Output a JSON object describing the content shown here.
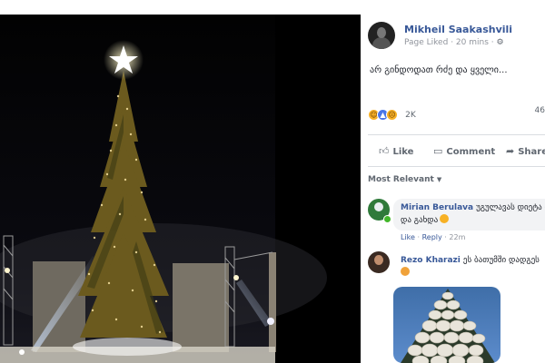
{
  "post": {
    "page_name": "Mikheil Saakashvili",
    "meta_status": "Page Liked",
    "meta_time": "20 mins",
    "text": "არ გინდოდათ რძე და ყველი...",
    "reaction_count": "2K",
    "comment_count": "46"
  },
  "actions": {
    "like": "Like",
    "comment": "Comment",
    "share": "Share"
  },
  "sort_label": "Most Relevant",
  "comments": [
    {
      "author": "Mirian Berulava",
      "text_line1": "უგულავას დიეტა დ",
      "text_line2": "და გახდა",
      "like": "Like",
      "reply": "Reply",
      "time": "22m"
    },
    {
      "author": "Rezo Kharazi",
      "text_line1": "ეს ბათუმში დადგეს"
    }
  ],
  "colors": {
    "link_blue": "#385898",
    "secondary_gray": "#606770",
    "bubble_gray": "#f2f3f5",
    "online_green": "#42b72a"
  },
  "icons": [
    "settings-gear-icon",
    "haha-reaction-icon",
    "like-reaction-icon",
    "sad-reaction-icon",
    "thumbs-up-icon",
    "comment-icon",
    "share-arrow-icon",
    "caret-down-icon"
  ]
}
